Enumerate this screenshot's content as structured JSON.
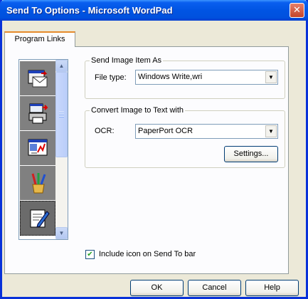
{
  "window": {
    "title": "Send To Options - Microsoft WordPad",
    "close_glyph": "✕"
  },
  "tabs": [
    {
      "label": "Program Links"
    }
  ],
  "program_list": {
    "icons": [
      "mail-program-icon",
      "fax-printer-icon",
      "graphics-program-icon",
      "paint-brushes-icon",
      "word-processor-icon"
    ],
    "selected_index": 4
  },
  "send_image": {
    "legend": "Send Image Item As",
    "file_type_label": "File type:",
    "file_type_value": "Windows Write,wri"
  },
  "convert_text": {
    "legend": "Convert Image to Text with",
    "ocr_label": "OCR:",
    "ocr_value": "PaperPort OCR",
    "settings_button": "Settings..."
  },
  "include_icon": {
    "label": "Include icon on Send To bar",
    "checked": true,
    "check_glyph": "✔"
  },
  "buttons": {
    "ok": "OK",
    "cancel": "Cancel",
    "help": "Help"
  }
}
